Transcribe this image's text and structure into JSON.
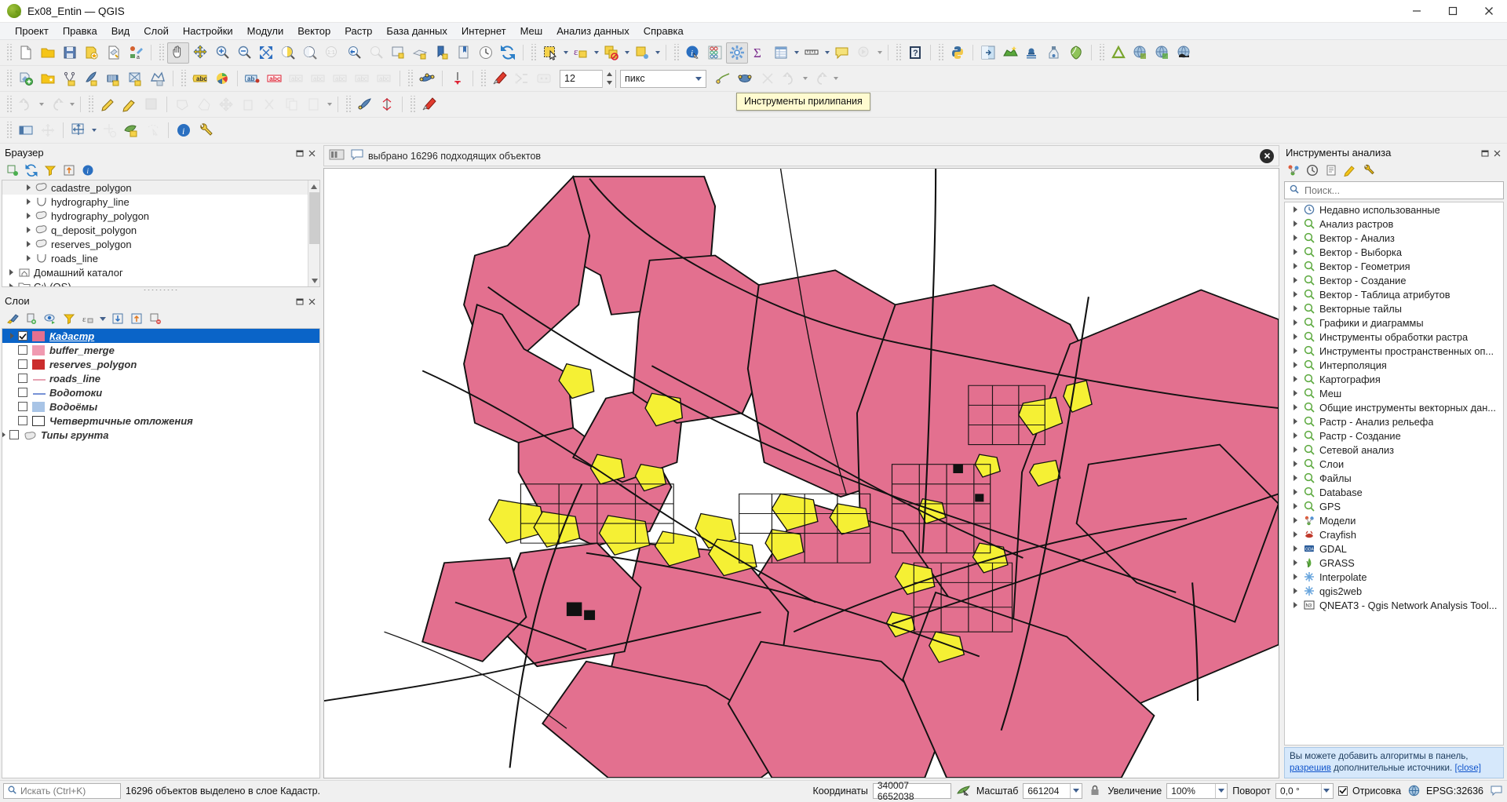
{
  "window": {
    "title": "Ex08_Entin — QGIS",
    "app_icon": "qgis-logo-icon",
    "minimize": "minimize-button",
    "maximize": "maximize-button",
    "close": "close-button"
  },
  "menu": {
    "items": [
      {
        "label": "Проект"
      },
      {
        "label": "Правка"
      },
      {
        "label": "Вид"
      },
      {
        "label": "Слой"
      },
      {
        "label": "Настройки"
      },
      {
        "label": "Модули"
      },
      {
        "label": "Вектор"
      },
      {
        "label": "Растр"
      },
      {
        "label": "База данных"
      },
      {
        "label": "Интернет"
      },
      {
        "label": "Меш"
      },
      {
        "label": "Анализ данных"
      },
      {
        "label": "Справка"
      }
    ]
  },
  "tooltip": {
    "text": "Инструменты прилипания"
  },
  "snapping_toolbar": {
    "tolerance_value": "12",
    "units_value": "пикс"
  },
  "browser_panel": {
    "title": "Браузер",
    "items": [
      {
        "label": "cadastre_polygon",
        "icon": "polygon-layer-icon",
        "indent": true,
        "highlighted": true
      },
      {
        "label": "hydrography_line",
        "icon": "line-layer-icon",
        "indent": true,
        "highlighted": false
      },
      {
        "label": "hydrography_polygon",
        "icon": "polygon-layer-icon",
        "indent": true,
        "highlighted": false
      },
      {
        "label": "q_deposit_polygon",
        "icon": "polygon-layer-icon",
        "indent": true,
        "highlighted": false
      },
      {
        "label": "reserves_polygon",
        "icon": "polygon-layer-icon",
        "indent": true,
        "highlighted": false
      },
      {
        "label": "roads_line",
        "icon": "line-layer-icon",
        "indent": true,
        "highlighted": false
      },
      {
        "label": "Домашний каталог",
        "icon": "home-folder-icon",
        "indent": false,
        "highlighted": false
      },
      {
        "label": "C:\\ (OS)",
        "icon": "drive-folder-icon",
        "indent": false,
        "highlighted": false
      }
    ]
  },
  "layers_panel": {
    "title": "Слои",
    "layers": [
      {
        "name": "Кадастр",
        "color": "#e3708f",
        "checked": true,
        "selected": true,
        "expandable": true,
        "symbol": "fill"
      },
      {
        "name": "buffer_merge",
        "color": "#f09ab1",
        "checked": false,
        "selected": false,
        "expandable": false,
        "symbol": "fill"
      },
      {
        "name": "reserves_polygon",
        "color": "#cb2d2d",
        "checked": false,
        "selected": false,
        "expandable": false,
        "symbol": "fill"
      },
      {
        "name": "roads_line",
        "color": "#e08a9f",
        "checked": false,
        "selected": false,
        "expandable": false,
        "symbol": "line"
      },
      {
        "name": "Водотоки",
        "color": "#5577cc",
        "checked": false,
        "selected": false,
        "expandable": false,
        "symbol": "line"
      },
      {
        "name": "Водоёмы",
        "color": "#a8c4e6",
        "checked": false,
        "selected": false,
        "expandable": false,
        "symbol": "fill"
      },
      {
        "name": "Четвертичные отложения",
        "color": "#ffffff",
        "checked": false,
        "selected": false,
        "expandable": false,
        "symbol": "fill"
      },
      {
        "name": "Типы грунта",
        "color": "#d9d9d9",
        "checked": false,
        "selected": false,
        "expandable": true,
        "symbol": "group"
      }
    ]
  },
  "message_bar": {
    "text": "выбрано 16296 подходящих объектов",
    "panel_icon": "panel-toggle-icon",
    "comment_icon": "comment-icon",
    "close_icon": "close-circle-icon"
  },
  "processing_panel": {
    "title": "Инструменты анализа",
    "search_placeholder": "Поиск...",
    "toolbar_icons": [
      "models-icon",
      "history-icon",
      "log-icon",
      "edit-model-icon",
      "options-icon"
    ],
    "items": [
      {
        "label": "Недавно использованные",
        "icon": "clock-icon"
      },
      {
        "label": "Анализ растров",
        "icon": "provider-qgis-icon"
      },
      {
        "label": "Вектор - Анализ",
        "icon": "provider-qgis-icon"
      },
      {
        "label": "Вектор - Выборка",
        "icon": "provider-qgis-icon"
      },
      {
        "label": "Вектор - Геометрия",
        "icon": "provider-qgis-icon"
      },
      {
        "label": "Вектор - Создание",
        "icon": "provider-qgis-icon"
      },
      {
        "label": "Вектор - Таблица атрибутов",
        "icon": "provider-qgis-icon"
      },
      {
        "label": "Векторные тайлы",
        "icon": "provider-qgis-icon"
      },
      {
        "label": "Графики и диаграммы",
        "icon": "provider-qgis-icon"
      },
      {
        "label": "Инструменты обработки растра",
        "icon": "provider-qgis-icon"
      },
      {
        "label": "Инструменты пространственных оп...",
        "icon": "provider-qgis-icon"
      },
      {
        "label": "Интерполяция",
        "icon": "provider-qgis-icon"
      },
      {
        "label": "Картография",
        "icon": "provider-qgis-icon"
      },
      {
        "label": "Меш",
        "icon": "provider-qgis-icon"
      },
      {
        "label": "Общие инструменты векторных дан...",
        "icon": "provider-qgis-icon"
      },
      {
        "label": "Растр - Анализ рельефа",
        "icon": "provider-qgis-icon"
      },
      {
        "label": "Растр - Создание",
        "icon": "provider-qgis-icon"
      },
      {
        "label": "Сетевой анализ",
        "icon": "provider-qgis-icon"
      },
      {
        "label": "Слои",
        "icon": "provider-qgis-icon"
      },
      {
        "label": "Файлы",
        "icon": "provider-qgis-icon"
      },
      {
        "label": "Database",
        "icon": "provider-qgis-icon"
      },
      {
        "label": "GPS",
        "icon": "provider-qgis-icon"
      },
      {
        "label": "Модели",
        "icon": "provider-models-icon"
      },
      {
        "label": "Crayfish",
        "icon": "provider-crayfish-icon"
      },
      {
        "label": "GDAL",
        "icon": "provider-gdal-icon"
      },
      {
        "label": "GRASS",
        "icon": "provider-grass-icon"
      },
      {
        "label": "Interpolate",
        "icon": "provider-interpolate-icon"
      },
      {
        "label": "qgis2web",
        "icon": "provider-qgis2web-icon"
      },
      {
        "label": "QNEAT3 - Qgis Network Analysis Tool...",
        "icon": "provider-qneat3-icon"
      }
    ],
    "note": {
      "prefix": "Вы можете добавить алгоритмы в панель, ",
      "link1": "разрешив",
      "middle": " дополнительные источники.  ",
      "link2": "[close]"
    }
  },
  "status_bar": {
    "search_placeholder": "Искать (Ctrl+K)",
    "search_icon": "search-icon",
    "selection_text": "16296 объектов выделено в слое Кадастр.",
    "coordinates_label": "Координаты",
    "coordinates_value": "340007  6652038",
    "scale_label": "Масштаб",
    "scale_value": "661204",
    "magnifier_label": "Увеличение",
    "magnifier_value": "100%",
    "rotation_label": "Поворот",
    "rotation_value": "0,0 °",
    "render_label": "Отрисовка",
    "render_checked": true,
    "crs_label": "EPSG:32636",
    "lock_icon": "lock-icon",
    "globe_icon": "globe-icon",
    "message_icon": "message-log-icon"
  },
  "colors": {
    "cadastre_fill": "#e3708f",
    "highlight_yellow": "#f5f034",
    "selection_blue": "#0a64c8",
    "map_background": "#ffffff"
  }
}
